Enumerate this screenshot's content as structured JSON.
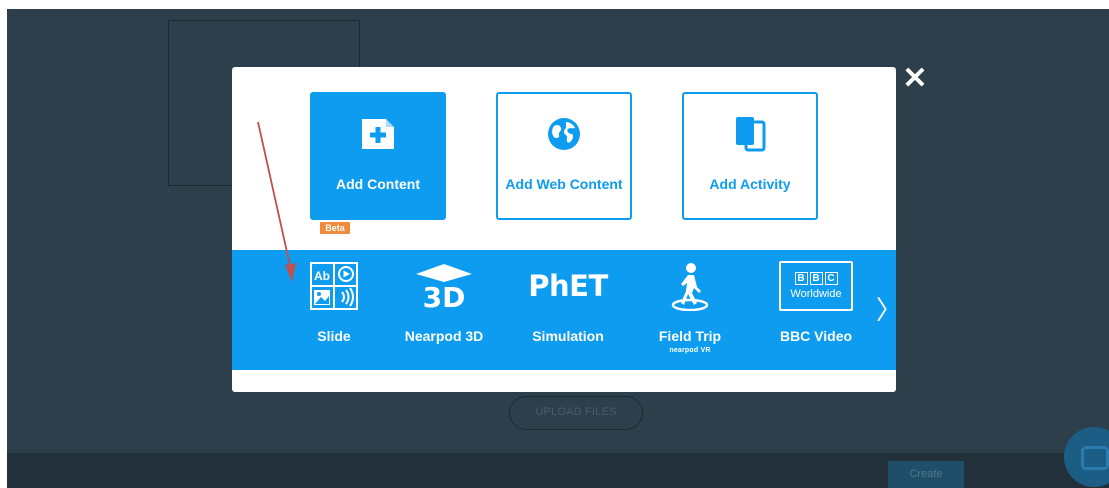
{
  "modal": {
    "close_label": "✕",
    "top_actions": [
      {
        "label": "Add Content",
        "icon": "add-content-icon"
      },
      {
        "label": "Add Web Content",
        "icon": "globe-icon"
      },
      {
        "label": "Add Activity",
        "icon": "activity-icon"
      }
    ],
    "content_types": [
      {
        "label": "Slide",
        "icon": "slide-icon",
        "badge": "Beta"
      },
      {
        "label": "Nearpod 3D",
        "icon": "3d-icon",
        "logo_text": "3D"
      },
      {
        "label": "Simulation",
        "icon": "phet-logo",
        "logo_text": "PhET"
      },
      {
        "label": "Field Trip",
        "icon": "field-trip-icon",
        "sublabel": "nearpod VR"
      },
      {
        "label": "BBC Video",
        "icon": "bbc-worldwide-logo",
        "logo_letters": [
          "B",
          "B",
          "C"
        ],
        "logo_word": "Worldwide"
      }
    ],
    "next_label": "〉"
  },
  "background": {
    "upload_files": "UPLOAD FILES",
    "create_button": "Create"
  },
  "colors": {
    "accent": "#0d9cf0",
    "backdrop": "#2d3f4a",
    "beta_badge": "#f08b3c",
    "annotation_arrow": "#c0504d"
  }
}
